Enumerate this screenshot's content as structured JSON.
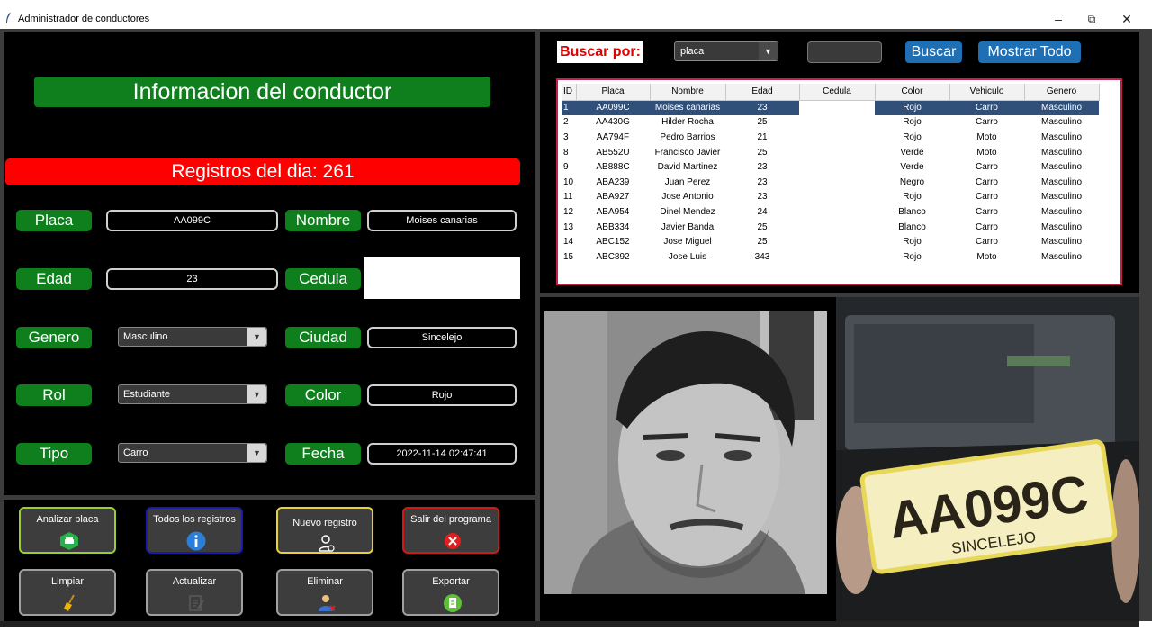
{
  "window": {
    "title": "Administrador de conductores",
    "minimize": "–",
    "maximize": "⧉",
    "close": "✕"
  },
  "info": {
    "heading": "Informacion del conductor",
    "registros": "Registros del dia: 261",
    "fields": {
      "placa": {
        "label": "Placa",
        "value": "AA099C"
      },
      "nombre": {
        "label": "Nombre",
        "value": "Moises canarias"
      },
      "edad": {
        "label": "Edad",
        "value": "23"
      },
      "cedula": {
        "label": "Cedula",
        "value": ""
      },
      "genero": {
        "label": "Genero",
        "value": "Masculino"
      },
      "ciudad": {
        "label": "Ciudad",
        "value": "Sincelejo"
      },
      "rol": {
        "label": "Rol",
        "value": "Estudiante"
      },
      "color": {
        "label": "Color",
        "value": "Rojo"
      },
      "tipo": {
        "label": "Tipo",
        "value": "Carro"
      },
      "fecha": {
        "label": "Fecha",
        "value": "2022-11-14 02:47:41"
      }
    }
  },
  "actions": {
    "analizar": {
      "label": "Analizar placa",
      "border": "#9acd32"
    },
    "todos": {
      "label": "Todos los registros",
      "border": "#1a1aa8"
    },
    "nuevo": {
      "label": "Nuevo registro",
      "border": "#e6d23a"
    },
    "salir": {
      "label": "Salir del programa",
      "border": "#d01a1a"
    },
    "limpiar": {
      "label": "Limpiar"
    },
    "actualizar": {
      "label": "Actualizar"
    },
    "eliminar": {
      "label": "Eliminar"
    },
    "exportar": {
      "label": "Exportar"
    }
  },
  "search": {
    "label": "Buscar por:",
    "select_value": "placa",
    "input_value": "",
    "buscar": "Buscar",
    "mostrar": "Mostrar Todo"
  },
  "table": {
    "columns": [
      "ID",
      "Placa",
      "Nombre",
      "Edad",
      "Cedula",
      "Color",
      "Vehiculo",
      "Genero"
    ],
    "rows": [
      [
        "1",
        "AA099C",
        "Moises canarias",
        "23",
        "",
        "Rojo",
        "Carro",
        "Masculino"
      ],
      [
        "2",
        "AA430G",
        "Hilder Rocha",
        "25",
        "",
        "Rojo",
        "Carro",
        "Masculino"
      ],
      [
        "3",
        "AA794F",
        "Pedro Barrios",
        "21",
        "",
        "Rojo",
        "Moto",
        "Masculino"
      ],
      [
        "8",
        "AB552U",
        "Francisco Javier",
        "25",
        "",
        "Verde",
        "Moto",
        "Masculino"
      ],
      [
        "9",
        "AB888C",
        "David Martinez",
        "23",
        "",
        "Verde",
        "Carro",
        "Masculino"
      ],
      [
        "10",
        "ABA239",
        "Juan Perez",
        "23",
        "",
        "Negro",
        "Carro",
        "Masculino"
      ],
      [
        "11",
        "ABA927",
        "Jose Antonio",
        "23",
        "",
        "Rojo",
        "Carro",
        "Masculino"
      ],
      [
        "12",
        "ABA954",
        "Dinel Mendez",
        "24",
        "",
        "Blanco",
        "Carro",
        "Masculino"
      ],
      [
        "13",
        "ABB334",
        "Javier Banda",
        "25",
        "",
        "Blanco",
        "Carro",
        "Masculino"
      ],
      [
        "14",
        "ABC152",
        "Jose Miguel",
        "25",
        "",
        "Rojo",
        "Carro",
        "Masculino"
      ],
      [
        "15",
        "ABC892",
        "Jose Luis",
        "343",
        "",
        "Rojo",
        "Moto",
        "Masculino"
      ]
    ],
    "selected_row": 0
  },
  "plate_image": {
    "plate_text": "AA099C",
    "city_text": "SINCELEJO"
  },
  "colors": {
    "green": "#0f7f1e",
    "red": "#ff0000",
    "blue": "#1f6fb5",
    "selection": "#30507a"
  }
}
